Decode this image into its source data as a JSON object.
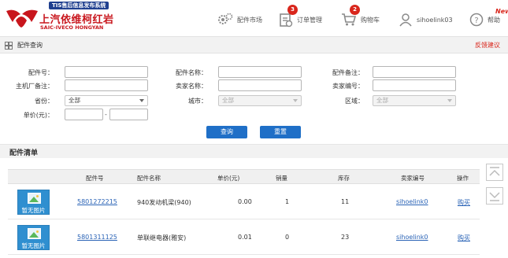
{
  "header": {
    "logo_badge": "TIS售后信息发布系统",
    "logo_cn": "上汽依维柯红岩",
    "logo_en": "SAIC-IVECO HONGYAN",
    "nav": {
      "market": "配件市场",
      "orders": "订单管理",
      "orders_badge": "3",
      "cart": "购物车",
      "cart_badge": "2",
      "user": "sihoelink03",
      "help": "帮助",
      "new_tag": "New"
    }
  },
  "toolbar": {
    "title": "配件查询",
    "feedback": "反馈建议"
  },
  "form": {
    "part_no_label": "配件号：",
    "part_name_label": "配件名称：",
    "part_note_label": "配件备注：",
    "oem_note_label": "主机厂备注：",
    "seller_name_label": "卖家名称：",
    "seller_no_label": "卖家编号：",
    "province_label": "省份：",
    "city_label": "城市：",
    "area_label": "区域：",
    "price_label": "单价(元)：",
    "province_value": "全部",
    "city_value": "全部",
    "area_value": "全部",
    "price_dash": "-",
    "search_btn": "查询",
    "reset_btn": "重置"
  },
  "list": {
    "title": "配件清单",
    "columns": [
      "配件号",
      "配件名称",
      "单价(元)",
      "销量",
      "库存",
      "卖家编号",
      "操作"
    ],
    "rows": [
      {
        "image_text": "暂无图片",
        "part_no": "5801272215",
        "name": "940发动机梁(940)",
        "price": "0.00",
        "sales": "1",
        "stock": "11",
        "seller": "sihoelink0",
        "action": "购买"
      },
      {
        "image_text": "暂无图片",
        "part_no": "5801311125",
        "name": "单联继电器(雅安)",
        "price": "0.01",
        "sales": "0",
        "stock": "23",
        "seller": "sihoelink0",
        "action": "购买"
      }
    ]
  },
  "colors": {
    "brand_red": "#c8161d",
    "primary_blue": "#1f6fc7",
    "link_blue": "#2a63b6"
  }
}
